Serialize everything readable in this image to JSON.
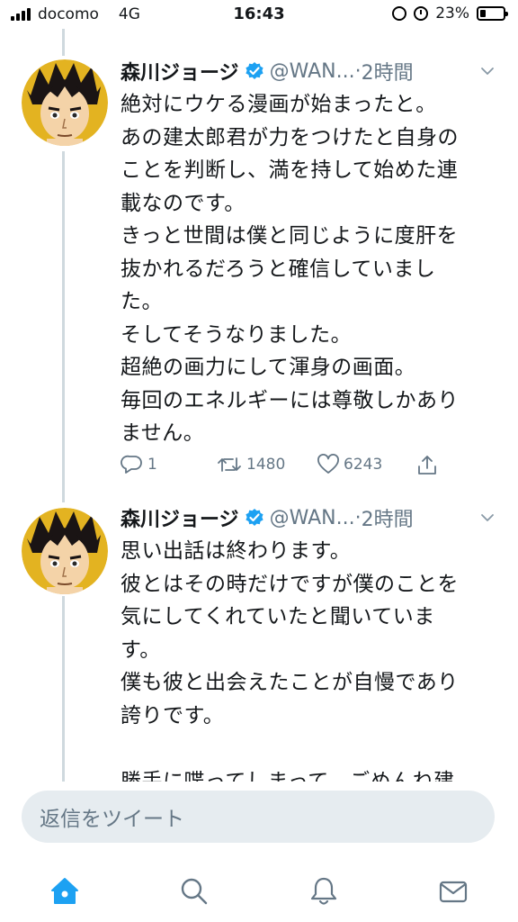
{
  "status_bar": {
    "carrier": "docomo",
    "network": "4G",
    "time": "16:43",
    "battery_percent": "23%",
    "battery_level": 0.23
  },
  "tweets": [
    {
      "author_name": "森川ジョージ",
      "handle": "@WAN...",
      "separator": "·",
      "time": "2時間",
      "verified": true,
      "lines": [
        "絶対にウケる漫画が始まったと。",
        "あの建太郎君が力をつけたと自身の",
        "ことを判断し、満を持して始めた連",
        "載なのです。",
        "きっと世間は僕と同じように度肝を",
        "抜かれるだろうと確信していまし",
        "た。",
        "そしてそうなりました。",
        "超絶の画力にして渾身の画面。",
        "毎回のエネルギーには尊敬しかあり",
        "ません。"
      ],
      "reply_count": "1",
      "retweet_count": "1480",
      "like_count": "6243"
    },
    {
      "author_name": "森川ジョージ",
      "handle": "@WAN...",
      "separator": "·",
      "time": "2時間",
      "verified": true,
      "lines": [
        "思い出話は終わります。",
        "彼とはその時だけですが僕のことを",
        "気にしてくれていたと聞いていま",
        "す。",
        "僕も彼と出会えたことが自慢であり",
        "誇りです。",
        "",
        "勝手に喋ってしまって、ごめんね建"
      ]
    }
  ],
  "reply_bar": {
    "placeholder": "返信をツイート"
  },
  "tab_bar": {
    "items": [
      {
        "name": "home-icon",
        "active": true
      },
      {
        "name": "search-icon",
        "active": false
      },
      {
        "name": "notifications-icon",
        "active": false
      },
      {
        "name": "messages-icon",
        "active": false
      }
    ]
  },
  "colors": {
    "accent": "#1da1f2",
    "text_primary": "#14171a",
    "text_secondary": "#657786",
    "thread_line": "#cfd9de",
    "reply_background": "#e6ecf0"
  }
}
